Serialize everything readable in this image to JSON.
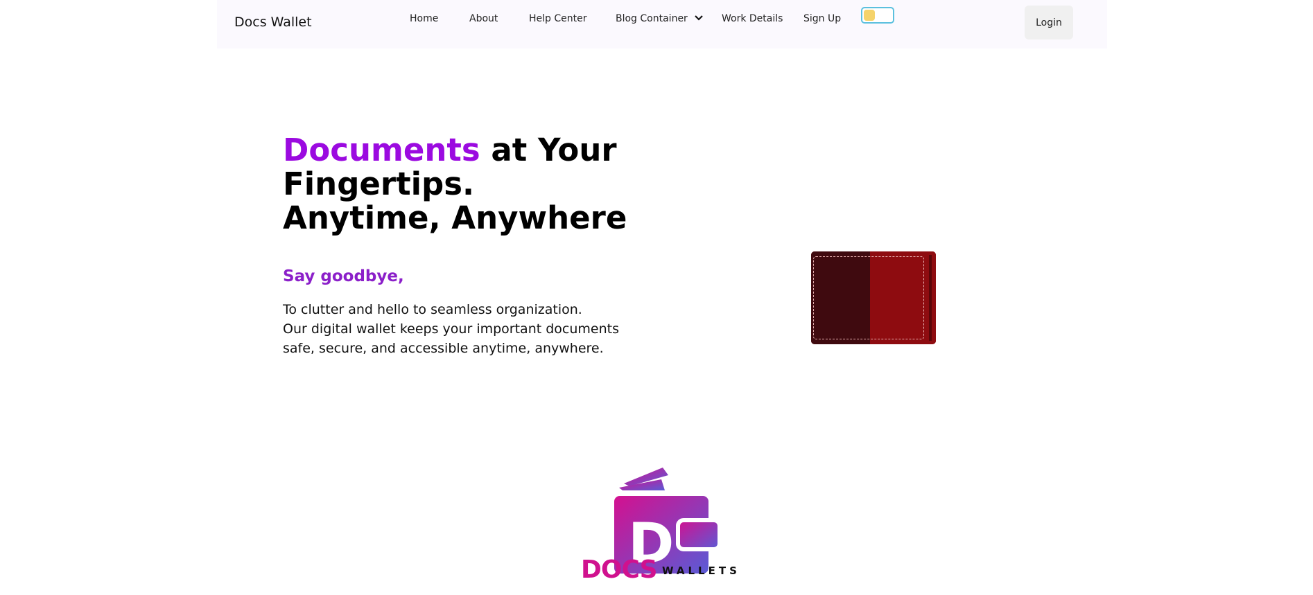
{
  "nav": {
    "brand": "Docs Wallet",
    "links": [
      "Home",
      "About",
      "Help Center",
      "Blog Container",
      "Work Details",
      "Sign Up"
    ],
    "login_label": "Login"
  },
  "hero": {
    "title_accent": "Documents",
    "title_rest_1": " at Your",
    "title_line_2": "Fingertips.",
    "title_line_3": "Anytime, Anywhere",
    "subhead": "Say goodbye,",
    "desc_lines": [
      "To clutter and hello to seamless organization.",
      "Our digital wallet keeps your important documents",
      "safe, secure, and accessible anytime, anywhere."
    ]
  },
  "logo": {
    "letter": "D",
    "word_1": "DOCS",
    "word_2": "WALLETS"
  },
  "colors": {
    "accent": "#9b0ae0",
    "nav_bg": "#fbf9fe",
    "wallet_dark": "#3f0a0f",
    "wallet_red": "#8e0c10"
  },
  "icons": {
    "toggle": "theme-toggle",
    "dropdown": "chevron-down-icon"
  }
}
